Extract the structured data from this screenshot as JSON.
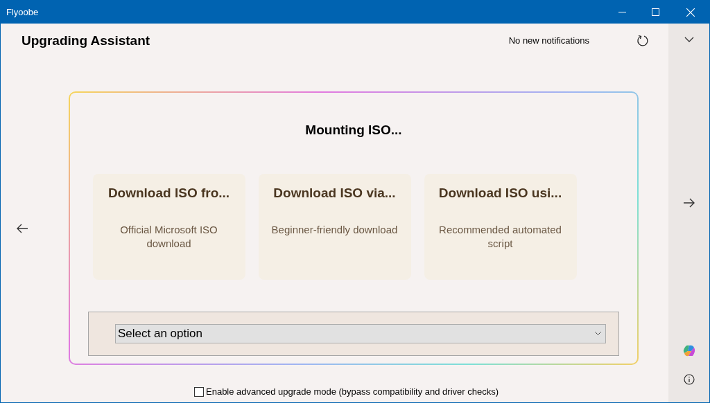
{
  "window": {
    "title": "Flyoobe"
  },
  "header": {
    "title": "Upgrading Assistant",
    "notifications": "No new notifications"
  },
  "panel": {
    "status": "Mounting ISO...",
    "options": [
      {
        "title": "Download ISO fro...",
        "description": "Official Microsoft ISO download"
      },
      {
        "title": "Download ISO via...",
        "description": "Beginner-friendly download"
      },
      {
        "title": "Download ISO usi...",
        "description": "Recommended automated script"
      }
    ],
    "dropdown": {
      "value": "Select an option"
    }
  },
  "advanced_mode": {
    "label": "Enable advanced upgrade mode (bypass compatibility and driver checks)",
    "checked": false
  }
}
